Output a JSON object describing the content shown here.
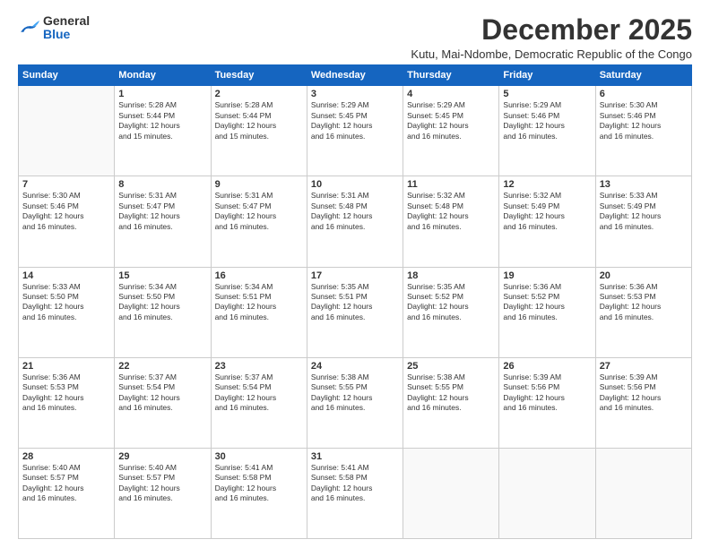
{
  "logo": {
    "general": "General",
    "blue": "Blue"
  },
  "header": {
    "month_year": "December 2025",
    "location": "Kutu, Mai-Ndombe, Democratic Republic of the Congo"
  },
  "weekdays": [
    "Sunday",
    "Monday",
    "Tuesday",
    "Wednesday",
    "Thursday",
    "Friday",
    "Saturday"
  ],
  "weeks": [
    [
      {
        "day": "",
        "info": ""
      },
      {
        "day": "1",
        "info": "Sunrise: 5:28 AM\nSunset: 5:44 PM\nDaylight: 12 hours\nand 15 minutes."
      },
      {
        "day": "2",
        "info": "Sunrise: 5:28 AM\nSunset: 5:44 PM\nDaylight: 12 hours\nand 15 minutes."
      },
      {
        "day": "3",
        "info": "Sunrise: 5:29 AM\nSunset: 5:45 PM\nDaylight: 12 hours\nand 16 minutes."
      },
      {
        "day": "4",
        "info": "Sunrise: 5:29 AM\nSunset: 5:45 PM\nDaylight: 12 hours\nand 16 minutes."
      },
      {
        "day": "5",
        "info": "Sunrise: 5:29 AM\nSunset: 5:46 PM\nDaylight: 12 hours\nand 16 minutes."
      },
      {
        "day": "6",
        "info": "Sunrise: 5:30 AM\nSunset: 5:46 PM\nDaylight: 12 hours\nand 16 minutes."
      }
    ],
    [
      {
        "day": "7",
        "info": "Sunrise: 5:30 AM\nSunset: 5:46 PM\nDaylight: 12 hours\nand 16 minutes."
      },
      {
        "day": "8",
        "info": "Sunrise: 5:31 AM\nSunset: 5:47 PM\nDaylight: 12 hours\nand 16 minutes."
      },
      {
        "day": "9",
        "info": "Sunrise: 5:31 AM\nSunset: 5:47 PM\nDaylight: 12 hours\nand 16 minutes."
      },
      {
        "day": "10",
        "info": "Sunrise: 5:31 AM\nSunset: 5:48 PM\nDaylight: 12 hours\nand 16 minutes."
      },
      {
        "day": "11",
        "info": "Sunrise: 5:32 AM\nSunset: 5:48 PM\nDaylight: 12 hours\nand 16 minutes."
      },
      {
        "day": "12",
        "info": "Sunrise: 5:32 AM\nSunset: 5:49 PM\nDaylight: 12 hours\nand 16 minutes."
      },
      {
        "day": "13",
        "info": "Sunrise: 5:33 AM\nSunset: 5:49 PM\nDaylight: 12 hours\nand 16 minutes."
      }
    ],
    [
      {
        "day": "14",
        "info": "Sunrise: 5:33 AM\nSunset: 5:50 PM\nDaylight: 12 hours\nand 16 minutes."
      },
      {
        "day": "15",
        "info": "Sunrise: 5:34 AM\nSunset: 5:50 PM\nDaylight: 12 hours\nand 16 minutes."
      },
      {
        "day": "16",
        "info": "Sunrise: 5:34 AM\nSunset: 5:51 PM\nDaylight: 12 hours\nand 16 minutes."
      },
      {
        "day": "17",
        "info": "Sunrise: 5:35 AM\nSunset: 5:51 PM\nDaylight: 12 hours\nand 16 minutes."
      },
      {
        "day": "18",
        "info": "Sunrise: 5:35 AM\nSunset: 5:52 PM\nDaylight: 12 hours\nand 16 minutes."
      },
      {
        "day": "19",
        "info": "Sunrise: 5:36 AM\nSunset: 5:52 PM\nDaylight: 12 hours\nand 16 minutes."
      },
      {
        "day": "20",
        "info": "Sunrise: 5:36 AM\nSunset: 5:53 PM\nDaylight: 12 hours\nand 16 minutes."
      }
    ],
    [
      {
        "day": "21",
        "info": "Sunrise: 5:36 AM\nSunset: 5:53 PM\nDaylight: 12 hours\nand 16 minutes."
      },
      {
        "day": "22",
        "info": "Sunrise: 5:37 AM\nSunset: 5:54 PM\nDaylight: 12 hours\nand 16 minutes."
      },
      {
        "day": "23",
        "info": "Sunrise: 5:37 AM\nSunset: 5:54 PM\nDaylight: 12 hours\nand 16 minutes."
      },
      {
        "day": "24",
        "info": "Sunrise: 5:38 AM\nSunset: 5:55 PM\nDaylight: 12 hours\nand 16 minutes."
      },
      {
        "day": "25",
        "info": "Sunrise: 5:38 AM\nSunset: 5:55 PM\nDaylight: 12 hours\nand 16 minutes."
      },
      {
        "day": "26",
        "info": "Sunrise: 5:39 AM\nSunset: 5:56 PM\nDaylight: 12 hours\nand 16 minutes."
      },
      {
        "day": "27",
        "info": "Sunrise: 5:39 AM\nSunset: 5:56 PM\nDaylight: 12 hours\nand 16 minutes."
      }
    ],
    [
      {
        "day": "28",
        "info": "Sunrise: 5:40 AM\nSunset: 5:57 PM\nDaylight: 12 hours\nand 16 minutes."
      },
      {
        "day": "29",
        "info": "Sunrise: 5:40 AM\nSunset: 5:57 PM\nDaylight: 12 hours\nand 16 minutes."
      },
      {
        "day": "30",
        "info": "Sunrise: 5:41 AM\nSunset: 5:58 PM\nDaylight: 12 hours\nand 16 minutes."
      },
      {
        "day": "31",
        "info": "Sunrise: 5:41 AM\nSunset: 5:58 PM\nDaylight: 12 hours\nand 16 minutes."
      },
      {
        "day": "",
        "info": ""
      },
      {
        "day": "",
        "info": ""
      },
      {
        "day": "",
        "info": ""
      }
    ]
  ]
}
